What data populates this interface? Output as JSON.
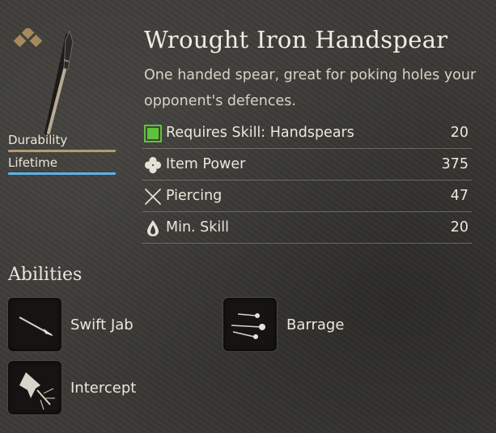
{
  "item": {
    "name": "Wrought Iron Handspear",
    "description": "One handed spear, great for poking holes your opponent's defences."
  },
  "bars": {
    "durability_label": "Durability",
    "lifetime_label": "Lifetime",
    "durability_color": "#b49c72",
    "lifetime_color": "#5ab2e6"
  },
  "stats": [
    {
      "icon": "skill-requirement-icon",
      "label": "Requires Skill:  Handspears",
      "value": "20"
    },
    {
      "icon": "clover-icon",
      "label": "Item Power",
      "value": "375"
    },
    {
      "icon": "crossed-swords-icon",
      "label": "Piercing",
      "value": "47"
    },
    {
      "icon": "drop-icon",
      "label": "Min. Skill",
      "value": "20"
    }
  ],
  "abilities": {
    "title": "Abilities",
    "items": [
      {
        "icon": "swift-jab-icon",
        "label": "Swift Jab"
      },
      {
        "icon": "barrage-icon",
        "label": "Barrage"
      },
      {
        "icon": "intercept-icon",
        "label": "Intercept"
      }
    ]
  },
  "colors": {
    "accent_green": "#5fc23a",
    "rarity_gold": "#a68a5c"
  }
}
